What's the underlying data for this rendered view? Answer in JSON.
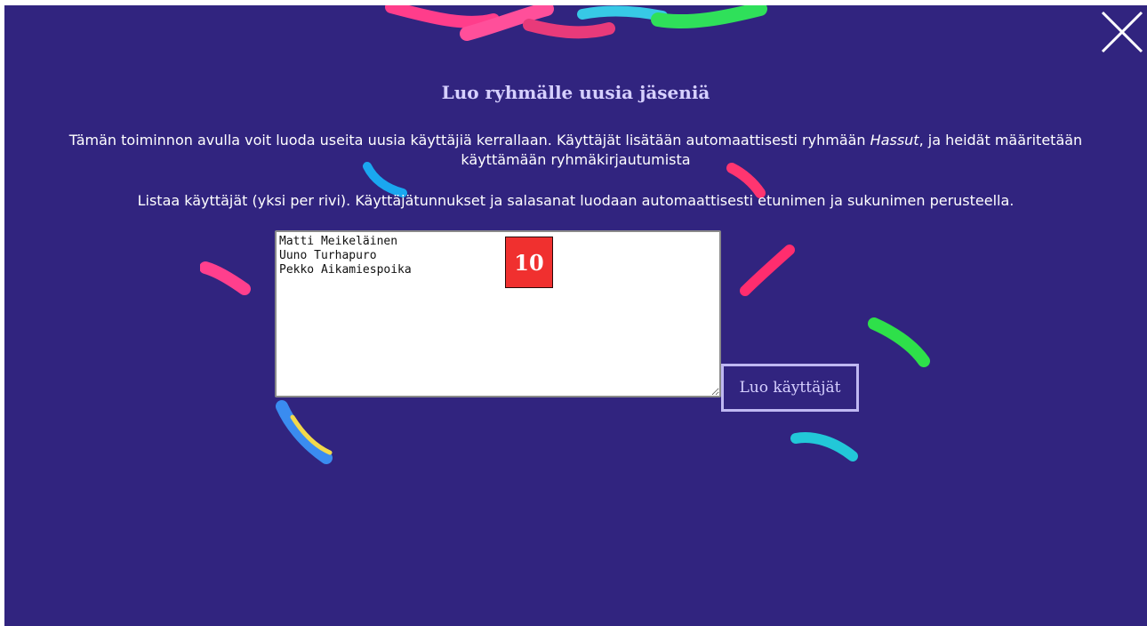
{
  "dialog": {
    "title": "Luo ryhmälle uusia jäseniä",
    "description_before": "Tämän toiminnon avulla voit luoda useita uusia käyttäjiä kerrallaan. Käyttäjät lisätään automaattisesti ryhmään ",
    "group_name": "Hassut",
    "description_after": ", ja heidät määritetään käyttämään ryhmäkirjautumista",
    "instructions": "Listaa käyttäjät (yksi per rivi). Käyttäjätunnukset ja salasanat luodaan automaattisesti etunimen ja sukunimen perusteella.",
    "users_text": "Matti Meikeläinen\nUuno Turhapuro\nPekko Aikamiespoika",
    "badge_number": "10",
    "submit_label": "Luo käyttäjät",
    "close_icon": "close-icon"
  },
  "colors": {
    "background": "#31247f",
    "title": "#d6d0ff",
    "badge": "#f0302f",
    "button_border": "#bfb8f2"
  }
}
